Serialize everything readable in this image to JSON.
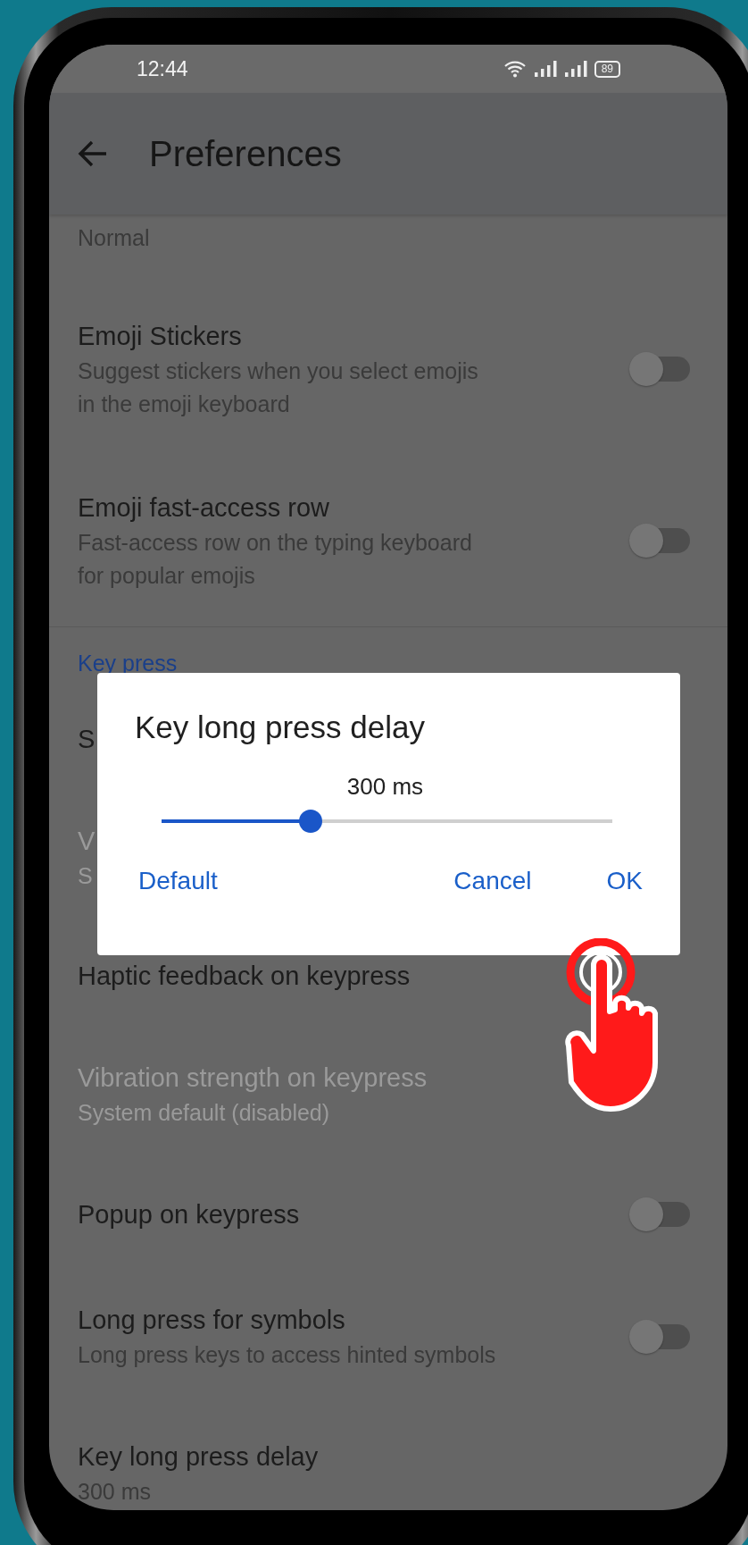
{
  "status_bar": {
    "time": "12:44",
    "battery": "89"
  },
  "app_bar": {
    "title": "Preferences"
  },
  "settings": [
    {
      "kind": "summary",
      "subtitle": "Normal"
    },
    {
      "kind": "toggle",
      "title": "Emoji Stickers",
      "subtitle": "Suggest stickers when you select emojis\nin the emoji keyboard",
      "on": false
    },
    {
      "kind": "toggle",
      "title": "Emoji fast-access row",
      "subtitle": "Fast-access row on the typing keyboard\nfor popular emojis",
      "on": false
    },
    {
      "kind": "header",
      "title": "Key press"
    },
    {
      "kind": "plain",
      "title": "S",
      "disabled": false
    },
    {
      "kind": "plain",
      "title": "V",
      "subtitle": "S",
      "disabled": true
    },
    {
      "kind": "plain",
      "title": "Haptic feedback on keypress",
      "disabled": false
    },
    {
      "kind": "plain",
      "title": "Vibration strength on keypress",
      "subtitle": "System default (disabled)",
      "disabled": true
    },
    {
      "kind": "toggle",
      "title": "Popup on keypress",
      "on": false
    },
    {
      "kind": "toggle",
      "title": "Long press for symbols",
      "subtitle": "Long press keys to access hinted symbols",
      "on": false
    },
    {
      "kind": "plain",
      "title": "Key long press delay",
      "subtitle": "300 ms",
      "disabled": false
    }
  ],
  "dialog": {
    "title": "Key long press delay",
    "reading": "300 ms",
    "level": 0.33,
    "buttons": [
      "Default",
      "Cancel",
      "OK"
    ]
  }
}
